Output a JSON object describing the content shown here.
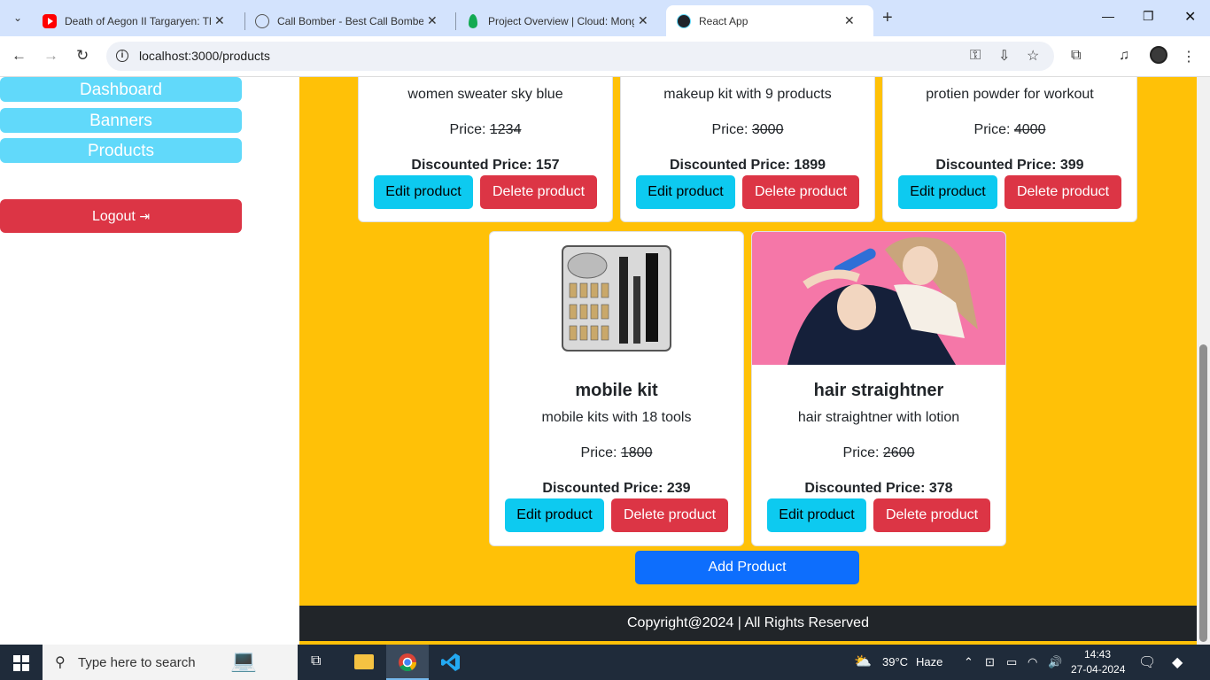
{
  "browser": {
    "tabs": [
      {
        "title": "Death of Aegon II Targaryen: Th",
        "icon": "youtube-icon"
      },
      {
        "title": "Call Bomber - Best Call Bomber",
        "icon": "globe-icon"
      },
      {
        "title": "Project Overview | Cloud: Mong",
        "icon": "mongodb-icon"
      },
      {
        "title": "React App",
        "icon": "react-icon"
      }
    ],
    "url": "localhost:3000/products"
  },
  "sidebar": {
    "dashboard": "Dashboard",
    "banners": "Banners",
    "products": "Products",
    "logout": "Logout"
  },
  "products_top": [
    {
      "description": "women sweater sky blue",
      "price_label": "Price:",
      "price": "1234",
      "discounted": "Discounted Price: 157"
    },
    {
      "description": "makeup kit with 9 products",
      "price_label": "Price:",
      "price": "3000",
      "discounted": "Discounted Price: 1899"
    },
    {
      "description": "protien powder for workout",
      "price_label": "Price:",
      "price": "4000",
      "discounted": "Discounted Price: 399"
    }
  ],
  "products_bottom": [
    {
      "name": "mobile kit",
      "description": "mobile kits with 18 tools",
      "price_label": "Price:",
      "price": "1800",
      "discounted": "Discounted Price: 239"
    },
    {
      "name": "hair straightner",
      "description": "hair straightner with lotion",
      "price_label": "Price:",
      "price": "2600",
      "discounted": "Discounted Price: 378"
    }
  ],
  "buttons": {
    "edit": "Edit product",
    "delete": "Delete product",
    "add": "Add Product"
  },
  "footer": "Copyright@2024 | All Rights Reserved",
  "taskbar": {
    "search_placeholder": "Type here to search",
    "weather_temp": "39°C",
    "weather_text": "Haze",
    "time": "14:43",
    "date": "27-04-2024"
  },
  "colors": {
    "main_bg": "#ffc107",
    "sidebar_btn": "#61d9fa",
    "danger": "#dc3545",
    "info": "#0dcaf0",
    "primary": "#0d6efd"
  }
}
